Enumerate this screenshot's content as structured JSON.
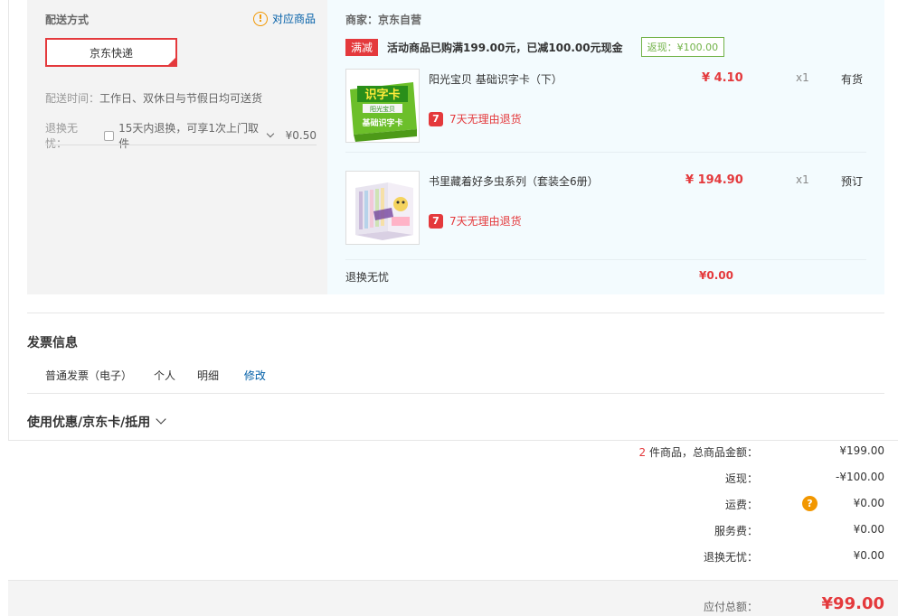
{
  "shipping": {
    "title": "配送方式",
    "notice_icon": "!",
    "notice_text": "对应商品",
    "method_selected": "京东快递",
    "time_label": "配送时间：",
    "time_value": "工作日、双休日与节假日均可送货",
    "return_label": "退换无忧：",
    "return_option": "15天内退换，可享1次上门取件",
    "return_price": "¥0.50"
  },
  "vendor": {
    "label": "商家：京东自营",
    "promo_tag": "满减",
    "promo_text": "活动商品已购满199.00元，已减100.00元现金",
    "rebate": "返现：¥100.00"
  },
  "items": [
    {
      "name": "阳光宝贝 基础识字卡（下）",
      "price": "¥ 4.10",
      "qty": "x1",
      "stock": "有货",
      "return_badge": "7",
      "return_text": "7天无理由退货",
      "thumb_title": "识字卡",
      "thumb_sub": "基础识字卡",
      "thumb_band": "阳光宝贝"
    },
    {
      "name": "书里藏着好多虫系列（套装全6册）",
      "price": "¥ 194.90",
      "qty": "x1",
      "stock": "预订",
      "return_badge": "7",
      "return_text": "7天无理由退货"
    }
  ],
  "return_worry": {
    "label": "退换无忧",
    "price": "¥0.00"
  },
  "invoice": {
    "title": "发票信息",
    "type": "普通发票（电子）",
    "holder": "个人",
    "content": "明细",
    "edit": "修改"
  },
  "coupon": {
    "title": "使用优惠/京东卡/抵用"
  },
  "summary": {
    "count": "2",
    "count_suffix": " 件商品，总商品金额：",
    "goods_total": "¥199.00",
    "rebate_label": "返现：",
    "rebate_value": "-¥100.00",
    "freight_label": "运费：",
    "freight_value": "¥0.00",
    "freight_icon": "?",
    "service_label": "服务费：",
    "service_value": "¥0.00",
    "return_label": "退换无忧：",
    "return_value": "¥0.00",
    "total_label": "应付总额：",
    "total_value": "¥99.00"
  },
  "colors": {
    "accent_red": "#e4393c",
    "link_blue": "#005ea7",
    "rebate_green": "#71b247",
    "warning_orange": "#f29700"
  }
}
